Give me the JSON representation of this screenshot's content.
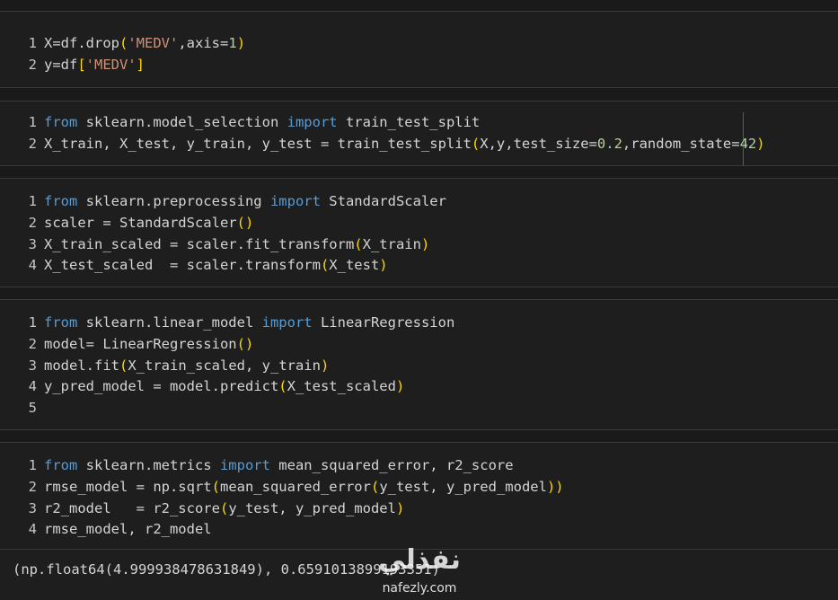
{
  "cells": [
    {
      "lines": [
        {
          "n": "1",
          "parts": [
            [
              "code",
              "X=df.drop"
            ],
            [
              "paren",
              "("
            ],
            [
              "str",
              "'MEDV'"
            ],
            [
              "code",
              ",axis="
            ],
            [
              "num",
              "1"
            ],
            [
              "paren",
              ")"
            ]
          ]
        },
        {
          "n": "2",
          "parts": [
            [
              "code",
              "y=df"
            ],
            [
              "paren",
              "["
            ],
            [
              "str",
              "'MEDV'"
            ],
            [
              "paren",
              "]"
            ]
          ]
        }
      ]
    },
    {
      "lines": [
        {
          "n": "1",
          "parts": [
            [
              "kw",
              "from"
            ],
            [
              "code",
              " sklearn.model_selection "
            ],
            [
              "kw",
              "import"
            ],
            [
              "code",
              " train_test_split"
            ]
          ]
        },
        {
          "n": "2",
          "parts": [
            [
              "code",
              "X_train, X_test, y_train, y_test = train_test_split"
            ],
            [
              "paren",
              "("
            ],
            [
              "code",
              "X,y,test_size="
            ],
            [
              "num",
              "0.2"
            ],
            [
              "code",
              ",random_state="
            ],
            [
              "num",
              "42"
            ],
            [
              "paren",
              ")"
            ]
          ]
        }
      ]
    },
    {
      "lines": [
        {
          "n": "1",
          "parts": [
            [
              "kw",
              "from"
            ],
            [
              "code",
              " sklearn.preprocessing "
            ],
            [
              "kw",
              "import"
            ],
            [
              "code",
              " StandardScaler"
            ]
          ]
        },
        {
          "n": "2",
          "parts": [
            [
              "code",
              "scaler = StandardScaler"
            ],
            [
              "paren",
              "()"
            ]
          ]
        },
        {
          "n": "3",
          "parts": [
            [
              "code",
              "X_train_scaled = scaler.fit_transform"
            ],
            [
              "paren",
              "("
            ],
            [
              "code",
              "X_train"
            ],
            [
              "paren",
              ")"
            ]
          ]
        },
        {
          "n": "4",
          "parts": [
            [
              "code",
              "X_test_scaled  = scaler.transform"
            ],
            [
              "paren",
              "("
            ],
            [
              "code",
              "X_test"
            ],
            [
              "paren",
              ")"
            ]
          ]
        }
      ]
    },
    {
      "lines": [
        {
          "n": "1",
          "parts": [
            [
              "kw",
              "from"
            ],
            [
              "code",
              " sklearn.linear_model "
            ],
            [
              "kw",
              "import"
            ],
            [
              "code",
              " LinearRegression"
            ]
          ]
        },
        {
          "n": "2",
          "parts": [
            [
              "code",
              "model= LinearRegression"
            ],
            [
              "paren",
              "()"
            ]
          ]
        },
        {
          "n": "3",
          "parts": [
            [
              "code",
              "model.fit"
            ],
            [
              "paren",
              "("
            ],
            [
              "code",
              "X_train_scaled, y_train"
            ],
            [
              "paren",
              ")"
            ]
          ]
        },
        {
          "n": "4",
          "parts": [
            [
              "code",
              "y_pred_model = model.predict"
            ],
            [
              "paren",
              "("
            ],
            [
              "code",
              "X_test_scaled"
            ],
            [
              "paren",
              ")"
            ]
          ]
        },
        {
          "n": "5",
          "parts": []
        }
      ]
    },
    {
      "lines": [
        {
          "n": "1",
          "parts": [
            [
              "kw",
              "from"
            ],
            [
              "code",
              " sklearn.metrics "
            ],
            [
              "kw",
              "import"
            ],
            [
              "code",
              " mean_squared_error, r2_score"
            ]
          ]
        },
        {
          "n": "2",
          "parts": [
            [
              "code",
              "rmse_model = np.sqrt"
            ],
            [
              "paren",
              "("
            ],
            [
              "code",
              "mean_squared_error"
            ],
            [
              "paren",
              "("
            ],
            [
              "code",
              "y_test, y_pred_model"
            ],
            [
              "paren",
              "))"
            ]
          ]
        },
        {
          "n": "3",
          "parts": [
            [
              "code",
              "r2_model   = r2_score"
            ],
            [
              "paren",
              "("
            ],
            [
              "code",
              "y_test, y_pred_model"
            ],
            [
              "paren",
              ")"
            ]
          ]
        },
        {
          "n": "4",
          "parts": [
            [
              "code",
              "rmse_model, r2_model"
            ]
          ]
        }
      ]
    }
  ],
  "output": {
    "text": "(np.float64(4.999938478631849), 0.6591013899193351)"
  },
  "watermark": {
    "arabic": "نفذلي",
    "latin": "nafezly.com"
  },
  "colors": {
    "keyword": "#569cd6",
    "string": "#ce9178",
    "number": "#b5cea8",
    "bracket": "#ffd700",
    "text": "#d4d4d4",
    "background": "#1e1e1e"
  }
}
